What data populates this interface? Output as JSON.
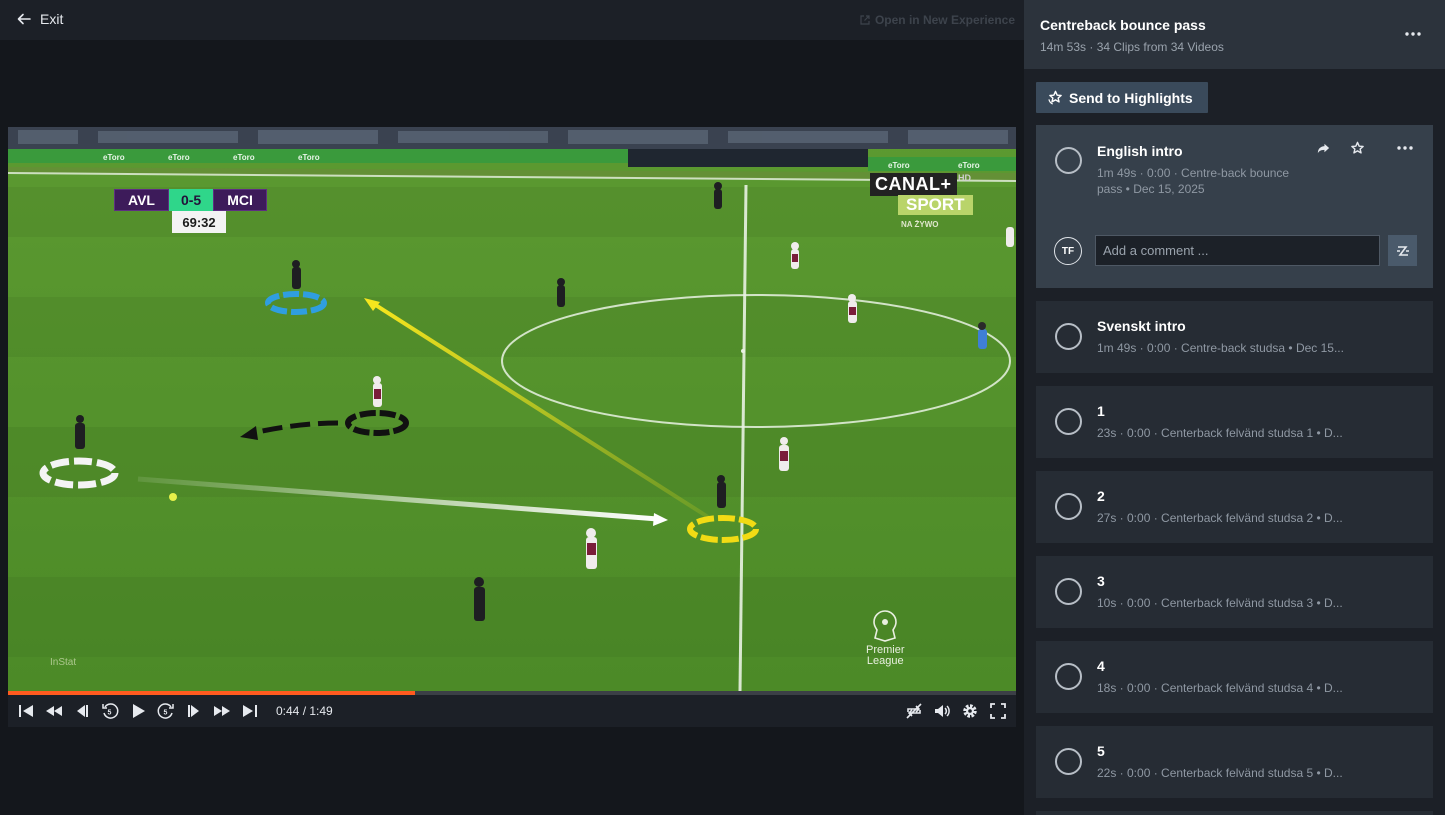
{
  "topbar": {
    "exit_label": "Exit",
    "open_new_label": "Open in New Experience"
  },
  "video": {
    "scoreboard": {
      "home": "AVL",
      "score": "0-5",
      "away": "MCI",
      "clock": "69:32"
    },
    "broadcaster": "CANAL+",
    "broadcaster_hd": "HD",
    "broadcaster_sport": "SPORT",
    "broadcaster_live": "NA ŻYWO",
    "instat": "InStat",
    "league_line1": "Premier",
    "league_line2": "League"
  },
  "player": {
    "time": "0:44 / 1:49",
    "progress_fraction": 0.404
  },
  "playlist": {
    "title": "Centreback bounce pass",
    "meta": "14m 53s · 34 Clips from 34 Videos",
    "send_label": "Send to Highlights",
    "comment_avatar": "TF",
    "comment_placeholder": "Add a comment ...",
    "clips": [
      {
        "title": "English intro",
        "meta": "1m 49s · 0:00 · Centre-back bounce",
        "meta2": "pass • Dec 15, 2025"
      },
      {
        "title": "Svenskt intro",
        "meta": "1m 49s · 0:00 · Centre-back studsa • Dec 15..."
      },
      {
        "title": "1",
        "meta": "23s · 0:00 · Centerback felvänd studsa 1 • D..."
      },
      {
        "title": "2",
        "meta": "27s · 0:00 · Centerback felvänd studsa 2 • D..."
      },
      {
        "title": "3",
        "meta": "10s · 0:00 · Centerback felvänd studsa 3 • D..."
      },
      {
        "title": "4",
        "meta": "18s · 0:00 · Centerback felvänd studsa 4 • D..."
      },
      {
        "title": "5",
        "meta": "22s · 0:00 · Centerback felvänd studsa 5 • D..."
      }
    ]
  },
  "colors": {
    "accent_progress": "#ff5a1f",
    "panel_bg": "#1c2027",
    "active_clip_bg": "#36404b"
  }
}
